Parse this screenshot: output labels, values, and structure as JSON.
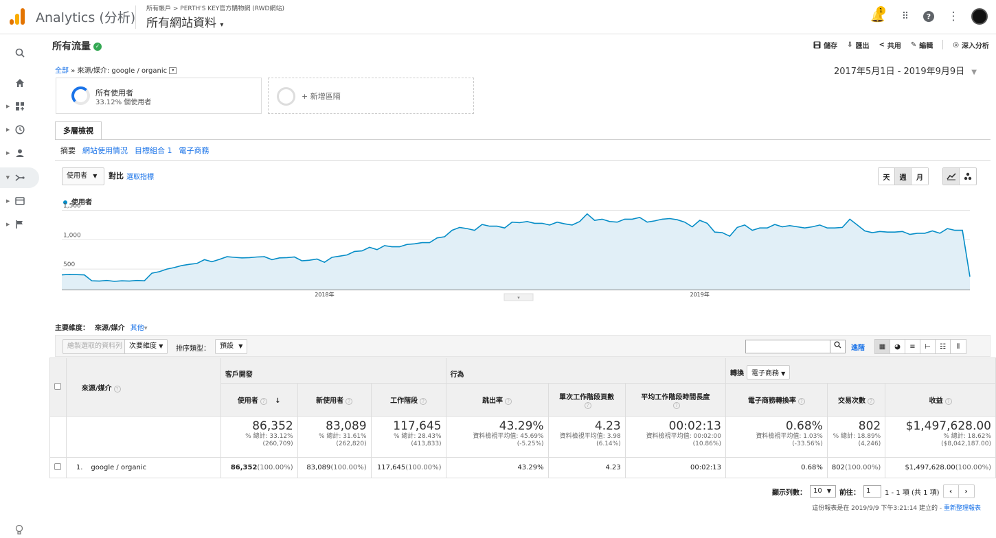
{
  "app": {
    "title": "Analytics (分析)",
    "account_crumb": "所有帳戶 > PERTH'S KEY官方購物網 (RWD網站)",
    "view_name": "所有網站資料",
    "notification_count": "1"
  },
  "colors": {
    "accent": "#1a73e8",
    "chart_line": "#058dc7",
    "chart_fill": "#e1eff7",
    "badge": "#fbbc04",
    "verified": "#34a853"
  },
  "report": {
    "title": "所有流量",
    "actions": {
      "save": "儲存",
      "export": "匯出",
      "share": "共用",
      "edit": "編輯",
      "insights": "深入分析"
    },
    "breadcrumb": {
      "root": "全部",
      "sep": "»",
      "current": "來源/媒介: google / organic"
    },
    "date_range": "2017年5月1日 - 2019年9月9日"
  },
  "segments": [
    {
      "name": "所有使用者",
      "sub": "33.12% 個使用者"
    },
    {
      "name": "+ 新增區隔"
    }
  ],
  "tabs": {
    "main": "多層檢視",
    "sub": [
      {
        "label": "摘要",
        "active": true
      },
      {
        "label": "網站使用情況"
      },
      {
        "label": "目標組合 1"
      },
      {
        "label": "電子商務"
      }
    ]
  },
  "chart_controls": {
    "metric": "使用者",
    "vs": "對比",
    "pick_metric": "選取指標",
    "granularity": [
      "天",
      "週",
      "月"
    ],
    "active_granularity": "週"
  },
  "chart_data": {
    "type": "area",
    "series": [
      {
        "name": "使用者",
        "values": [
          400,
          410,
          405,
          400,
          300,
          295,
          305,
          290,
          300,
          295,
          305,
          300,
          430,
          455,
          500,
          525,
          560,
          580,
          595,
          660,
          625,
          665,
          710,
          700,
          690,
          695,
          705,
          710,
          660,
          690,
          695,
          705,
          640,
          650,
          670,
          615,
          700,
          720,
          740,
          800,
          810,
          870,
          830,
          900,
          880,
          880,
          920,
          930,
          950,
          950,
          1030,
          1050,
          1160,
          1210,
          1190,
          1160,
          1260,
          1230,
          1230,
          1200,
          1300,
          1290,
          1310,
          1280,
          1280,
          1250,
          1300,
          1270,
          1250,
          1310,
          1440,
          1330,
          1350,
          1310,
          1300,
          1350,
          1350,
          1380,
          1300,
          1320,
          1350,
          1360,
          1340,
          1300,
          1220,
          1330,
          1280,
          1130,
          1120,
          1060,
          1210,
          1250,
          1160,
          1200,
          1200,
          1260,
          1220,
          1240,
          1220,
          1200,
          1220,
          1250,
          1200,
          1200,
          1210,
          1350,
          1250,
          1150,
          1120,
          1140,
          1130,
          1130,
          1140,
          1090,
          1110,
          1110,
          1150,
          1110,
          1190,
          1160,
          1160,
          370
        ]
      }
    ],
    "yticks": [
      500,
      1000,
      1500
    ],
    "xticks": [
      "2018年",
      "2019年"
    ],
    "ylim": [
      150,
      1600
    ],
    "grid": true
  },
  "table": {
    "primary_dim_label": "主要維度：",
    "primary_dim": "來源/媒介",
    "other": "其他",
    "toolbar": {
      "plot_rows": "繪製選取的資料列",
      "secondary": "次要維度",
      "sort_label": "排序類型：",
      "sort_value": "預設",
      "advanced": "進階"
    },
    "groups": {
      "acq": "客戶開發",
      "beh": "行為",
      "conv": "轉換",
      "conv_select": "電子商務"
    },
    "dim_header": "來源/媒介",
    "columns": [
      "使用者",
      "新使用者",
      "工作階段",
      "跳出率",
      "單次工作階段頁數",
      "平均工作階段時間長度",
      "電子商務轉換率",
      "交易次數",
      "收益"
    ],
    "totals": [
      {
        "big": "86,352",
        "l1": "% 總計: 33.12%",
        "l2": "(260,709)"
      },
      {
        "big": "83,089",
        "l1": "% 總計: 31.61%",
        "l2": "(262,820)"
      },
      {
        "big": "117,645",
        "l1": "% 總計: 28.43%",
        "l2": "(413,833)"
      },
      {
        "big": "43.29%",
        "l1": "資料檢視平均值: 45.69%",
        "l2": "(-5.25%)"
      },
      {
        "big": "4.23",
        "l1": "資料檢視平均值: 3.98",
        "l2": "(6.14%)"
      },
      {
        "big": "00:02:13",
        "l1": "資料檢視平均值: 00:02:00",
        "l2": "(10.86%)"
      },
      {
        "big": "0.68%",
        "l1": "資料檢視平均值: 1.03%",
        "l2": "(-33.56%)"
      },
      {
        "big": "802",
        "l1": "% 總計: 18.89%",
        "l2": "(4,246)"
      },
      {
        "big": "$1,497,628.00",
        "l1": "% 總計: 18.62%",
        "l2": "($8,042,187.00)"
      }
    ],
    "rows": [
      {
        "idx": "1.",
        "dim": "google / organic",
        "cells": [
          {
            "v": "86,352",
            "p": "(100.00%)"
          },
          {
            "v": "83,089",
            "p": "(100.00%)"
          },
          {
            "v": "117,645",
            "p": "(100.00%)"
          },
          {
            "v": "43.29%",
            "p": ""
          },
          {
            "v": "4.23",
            "p": ""
          },
          {
            "v": "00:02:13",
            "p": ""
          },
          {
            "v": "0.68%",
            "p": ""
          },
          {
            "v": "802",
            "p": "(100.00%)"
          },
          {
            "v": "$1,497,628.00",
            "p": "(100.00%)"
          }
        ]
      }
    ]
  },
  "pager": {
    "rows_label": "顯示列數：",
    "rows_value": "10",
    "goto_label": "前往：",
    "goto_value": "1",
    "range": "1 - 1 項 (共 1 項)",
    "prev": "‹",
    "next": "›"
  },
  "footnote": {
    "text": "這份報表是在 2019/9/9 下午3:21:14 建立的 - ",
    "link": "重新整理報表"
  }
}
